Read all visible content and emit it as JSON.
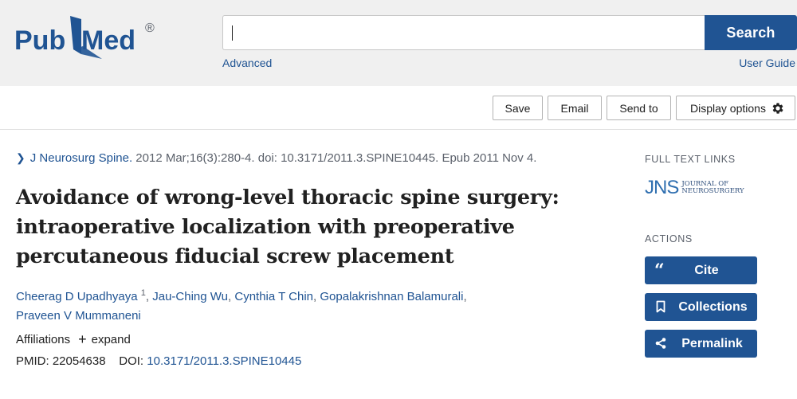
{
  "header": {
    "logo": {
      "text_pub": "Pub",
      "text_med": "Med",
      "registered": "®"
    },
    "search": {
      "value": "",
      "placeholder": "",
      "button_label": "Search"
    },
    "advanced_label": "Advanced",
    "user_guide_label": "User Guide"
  },
  "toolbar": {
    "save_label": "Save",
    "email_label": "Email",
    "send_to_label": "Send to",
    "display_options_label": "Display options"
  },
  "article": {
    "journal": "J Neurosurg Spine.",
    "citation_rest": " 2012 Mar;16(3):280-4. doi: 10.3171/2011.3.SPINE10445. Epub 2011 Nov 4.",
    "title": "Avoidance of wrong-level thoracic spine surgery: intraoperative localization with preoperative percutaneous fiducial screw placement",
    "authors": [
      {
        "name": "Cheerag D Upadhyaya",
        "affil": "1"
      },
      {
        "name": "Jau-Ching Wu"
      },
      {
        "name": "Cynthia T Chin"
      },
      {
        "name": "Gopalakrishnan Balamurali"
      },
      {
        "name": "Praveen V Mummaneni"
      }
    ],
    "affiliations_label": "Affiliations",
    "expand_label": "expand",
    "pmid_label": "PMID:",
    "pmid": "22054638",
    "doi_label": "DOI:",
    "doi": "10.3171/2011.3.SPINE10445"
  },
  "sidebar": {
    "full_text_heading": "FULL TEXT LINKS",
    "publisher_logo": {
      "letters": "JNS",
      "line1": "JOURNAL OF",
      "line2": "NEUROSURGERY"
    },
    "actions_heading": "ACTIONS",
    "actions": [
      {
        "label": "Cite",
        "icon": "quote-icon"
      },
      {
        "label": "Collections",
        "icon": "bookmark-icon"
      },
      {
        "label": "Permalink",
        "icon": "share-icon"
      }
    ]
  },
  "colors": {
    "primary": "#205493",
    "header_bg": "#f0f0f0",
    "muted_text": "#5b616b"
  }
}
